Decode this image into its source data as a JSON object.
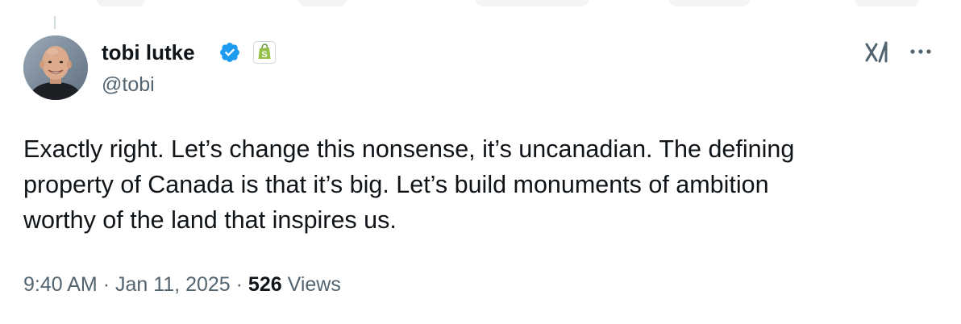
{
  "tweet": {
    "author": {
      "name": "tobi lutke",
      "handle": "@tobi",
      "verified_color": "#1d9bf0",
      "affiliate_badge_color": "#95bf47",
      "avatar_icon": "profile-photo"
    },
    "text_lines": [
      "Exactly right. Let’s change this nonsense, it’s uncanadian. The defining",
      "property of Canada is that it’s big. Let’s build monuments of ambition",
      "worthy of the land that inspires us."
    ],
    "time": "9:40 AM",
    "separator": "·",
    "date": "Jan 11, 2025",
    "views_count": "526",
    "views_label": "Views"
  },
  "actions": {
    "grok_icon": "grok-icon",
    "more_icon": "more-icon"
  },
  "colors": {
    "text_primary": "#0f1419",
    "text_secondary": "#536471",
    "thread_line": "#cfd9de"
  }
}
